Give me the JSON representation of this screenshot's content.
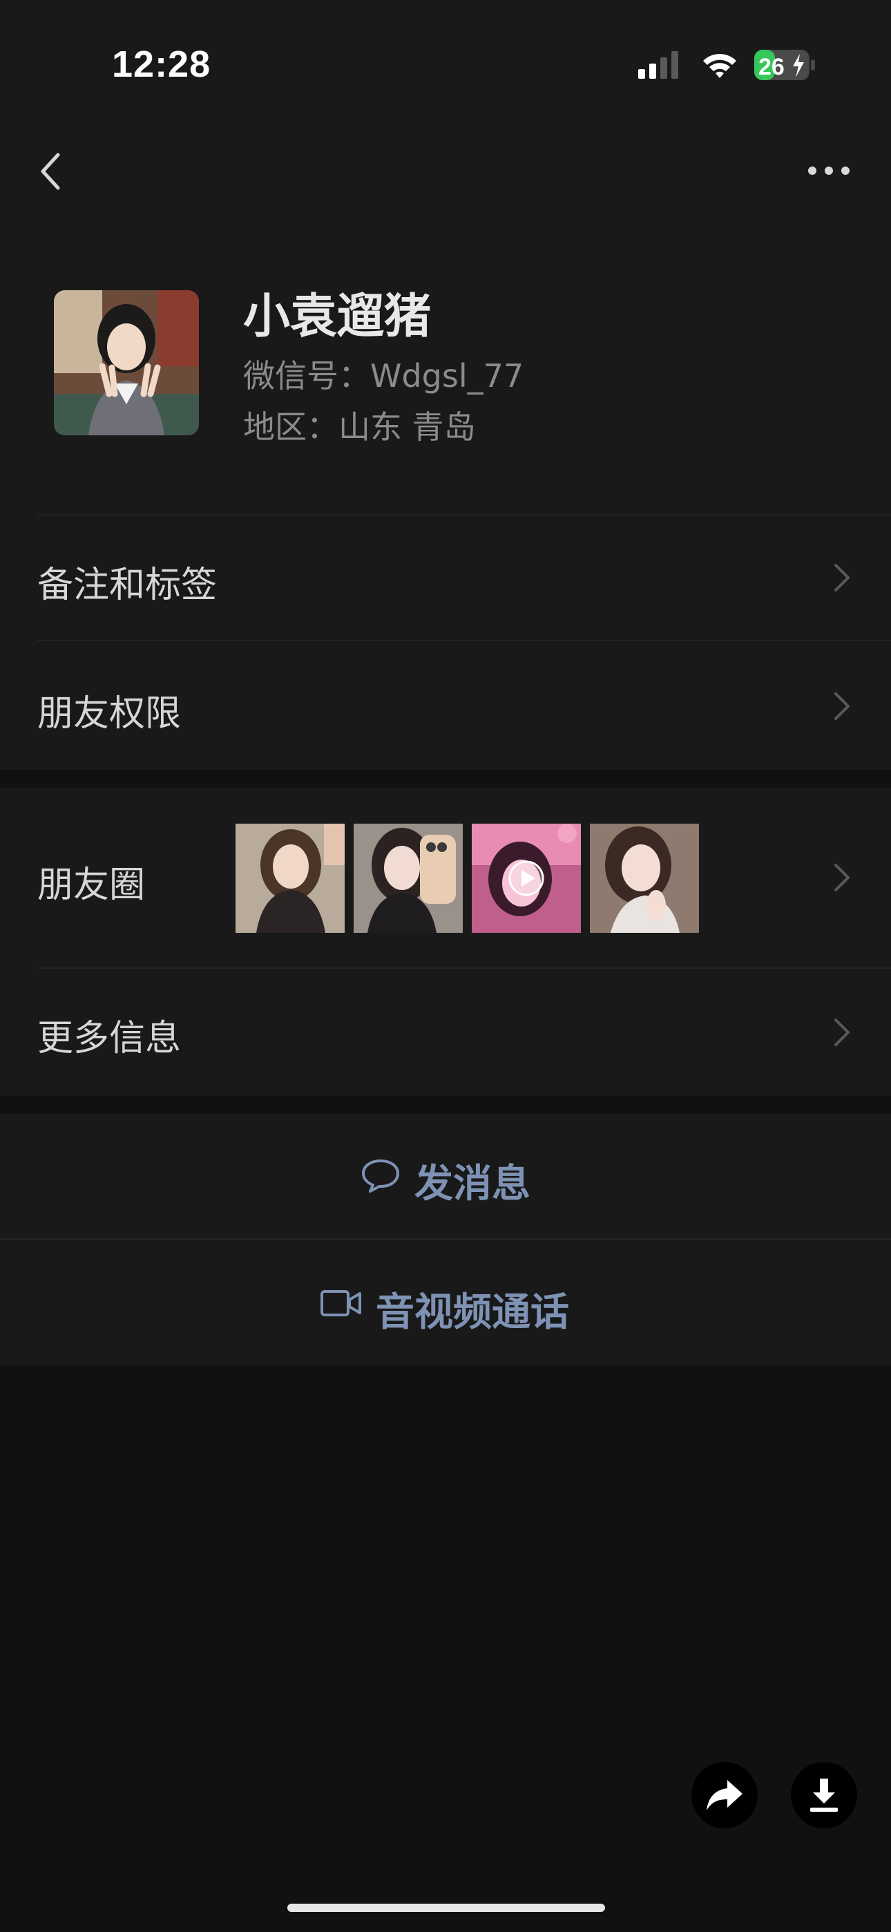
{
  "status_bar": {
    "time": "12:28",
    "battery": "26",
    "icons": [
      "cellular-signal-icon",
      "wifi-icon",
      "battery-charging-icon"
    ]
  },
  "nav": {
    "back_icon": "chevron-left-icon",
    "more_icon": "ellipsis-icon"
  },
  "profile": {
    "name": "小袁遛猪",
    "wechat_id": "微信号：Wdgsl_77",
    "region": "地区：山东 青岛"
  },
  "rows": {
    "remarks_tags": "备注和标签",
    "friend_permissions": "朋友权限",
    "moments": "朋友圈",
    "more_info": "更多信息"
  },
  "actions": {
    "send_message": "发消息",
    "av_call": "音视频通话"
  },
  "floating": {
    "share_icon": "share-arrow-icon",
    "download_icon": "download-icon"
  },
  "colors": {
    "background": "#191919",
    "page_bottom": "#111111",
    "action_text": "#7e92b4",
    "battery_green": "#35c759"
  }
}
